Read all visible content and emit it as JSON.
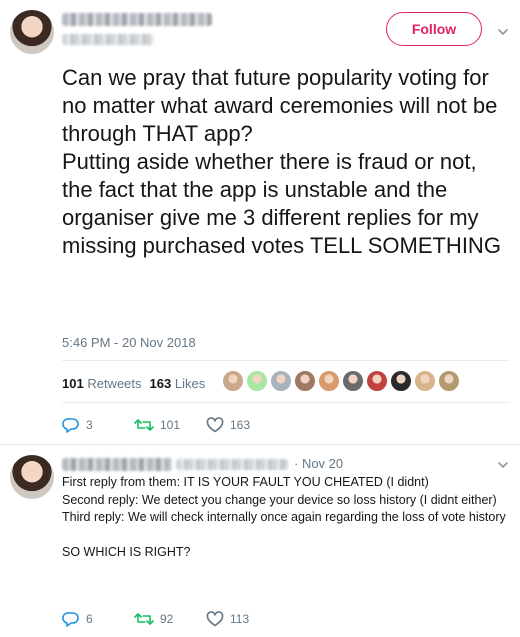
{
  "main_tweet": {
    "follow_label": "Follow",
    "paragraphs": [
      "Can we pray that future popularity voting for no matter what award ceremonies will not be through THAT app?",
      "Putting aside whether there is fraud or not, the fact that the app is unstable and the organiser give me 3 different replies for my missing purchased votes TELL SOMETHING"
    ],
    "timestamp": "5:46 PM - 20 Nov 2018",
    "retweets_count": "101",
    "retweets_label": "Retweets",
    "likes_count": "163",
    "likes_label": "Likes",
    "actions": {
      "reply_count": "3",
      "retweet_count": "101",
      "like_count": "163"
    },
    "liker_avatars": [
      "#c9a98a",
      "#a8e6a1",
      "#aab3bb",
      "#9e7a63",
      "#d99a6c",
      "#6b6b6b",
      "#c1423f",
      "#2a2a2a",
      "#d8b48a",
      "#b39a6e"
    ]
  },
  "reply_tweet": {
    "date": "· Nov 20",
    "lines": [
      "First reply from them: IT IS YOUR FAULT YOU CHEATED (I didnt)",
      "Second reply: We detect you change your device so loss history (I didnt either)",
      "Third reply: We will check internally once again regarding the loss of vote history",
      "",
      "SO WHICH IS RIGHT?"
    ],
    "actions": {
      "reply_count": "6",
      "retweet_count": "92",
      "like_count": "113"
    }
  },
  "colors": {
    "accent": "#e0245e",
    "muted": "#657786",
    "icon": "#8899a6",
    "divider": "#e6ecf0"
  }
}
